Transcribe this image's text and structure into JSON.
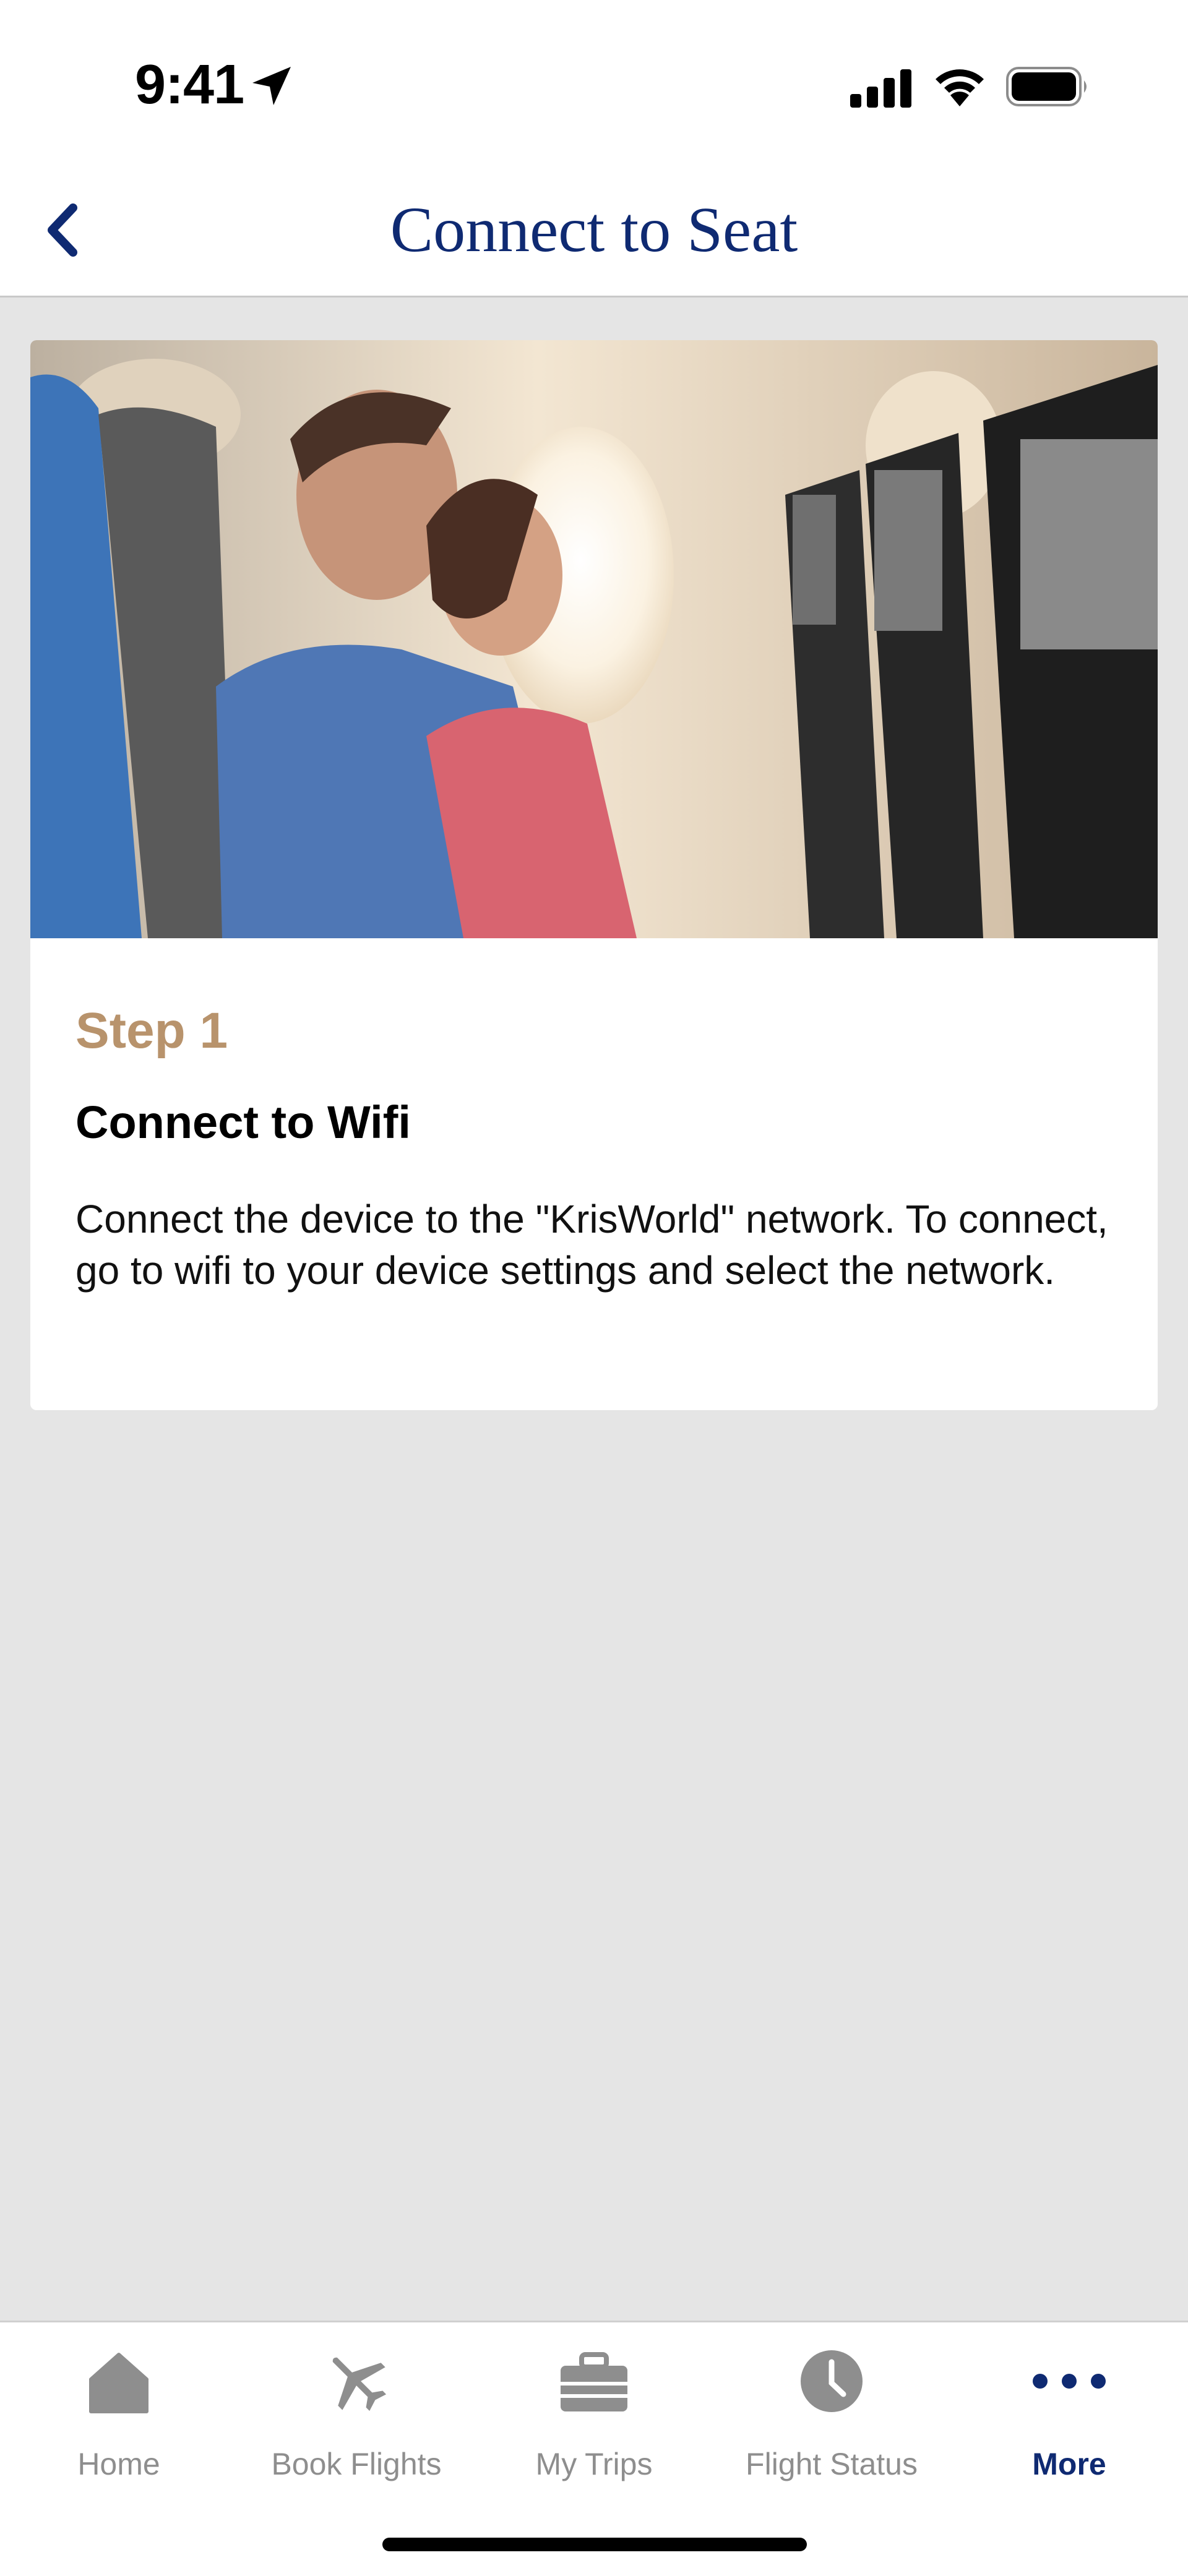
{
  "status_bar": {
    "time": "9:41"
  },
  "header": {
    "title": "Connect to Seat"
  },
  "card": {
    "step_label": "Step 1",
    "step_title": "Connect to Wifi",
    "step_description": "Connect the device to the \"KrisWorld\" network. To connect, go to wifi to your device settings and select the network."
  },
  "tabs": [
    {
      "label": "Home",
      "icon": "home-icon",
      "active": false
    },
    {
      "label": "Book Flights",
      "icon": "airplane-icon",
      "active": false
    },
    {
      "label": "My Trips",
      "icon": "suitcase-icon",
      "active": false
    },
    {
      "label": "Flight Status",
      "icon": "clock-icon",
      "active": false
    },
    {
      "label": "More",
      "icon": "more-dots-icon",
      "active": true
    }
  ],
  "colors": {
    "brand_navy": "#0f2a72",
    "step_gold": "#b8936c",
    "inactive_gray": "#8e8e8e",
    "background": "#e5e5e5"
  }
}
